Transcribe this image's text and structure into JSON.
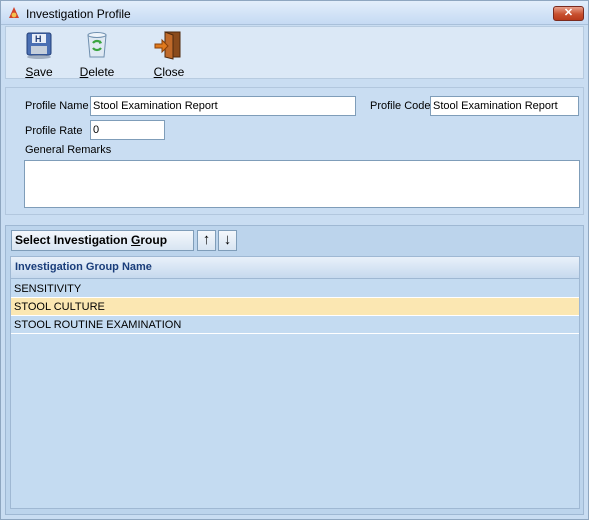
{
  "window": {
    "title": "Investigation Profile",
    "close_glyph": "✕"
  },
  "toolbar": {
    "save": {
      "prefix": "",
      "accel": "S",
      "rest": "ave",
      "icon": "save-icon"
    },
    "delete": {
      "prefix": "",
      "accel": "D",
      "rest": "elete",
      "icon": "recycle-bin-icon"
    },
    "close": {
      "prefix": "",
      "accel": "C",
      "rest": "lose",
      "icon": "exit-door-icon"
    }
  },
  "form": {
    "profile_name_label": "Profile Name",
    "profile_name_value": "Stool Examination Report",
    "profile_code_label": "Profile Code",
    "profile_code_value": "Stool Examination Report",
    "profile_rate_label": "Profile Rate",
    "profile_rate_value": "0",
    "general_remarks_label": "General Remarks",
    "general_remarks_value": ""
  },
  "group": {
    "button_prefix": "Select Investigation ",
    "button_accel": "G",
    "button_rest": "roup",
    "up_glyph": "↑",
    "down_glyph": "↓"
  },
  "grid": {
    "header": "Investigation Group Name",
    "rows": [
      {
        "name": "SENSITIVITY",
        "selected": false
      },
      {
        "name": "STOOL CULTURE",
        "selected": true
      },
      {
        "name": "STOOL ROUTINE EXAMINATION",
        "selected": false
      }
    ]
  }
}
